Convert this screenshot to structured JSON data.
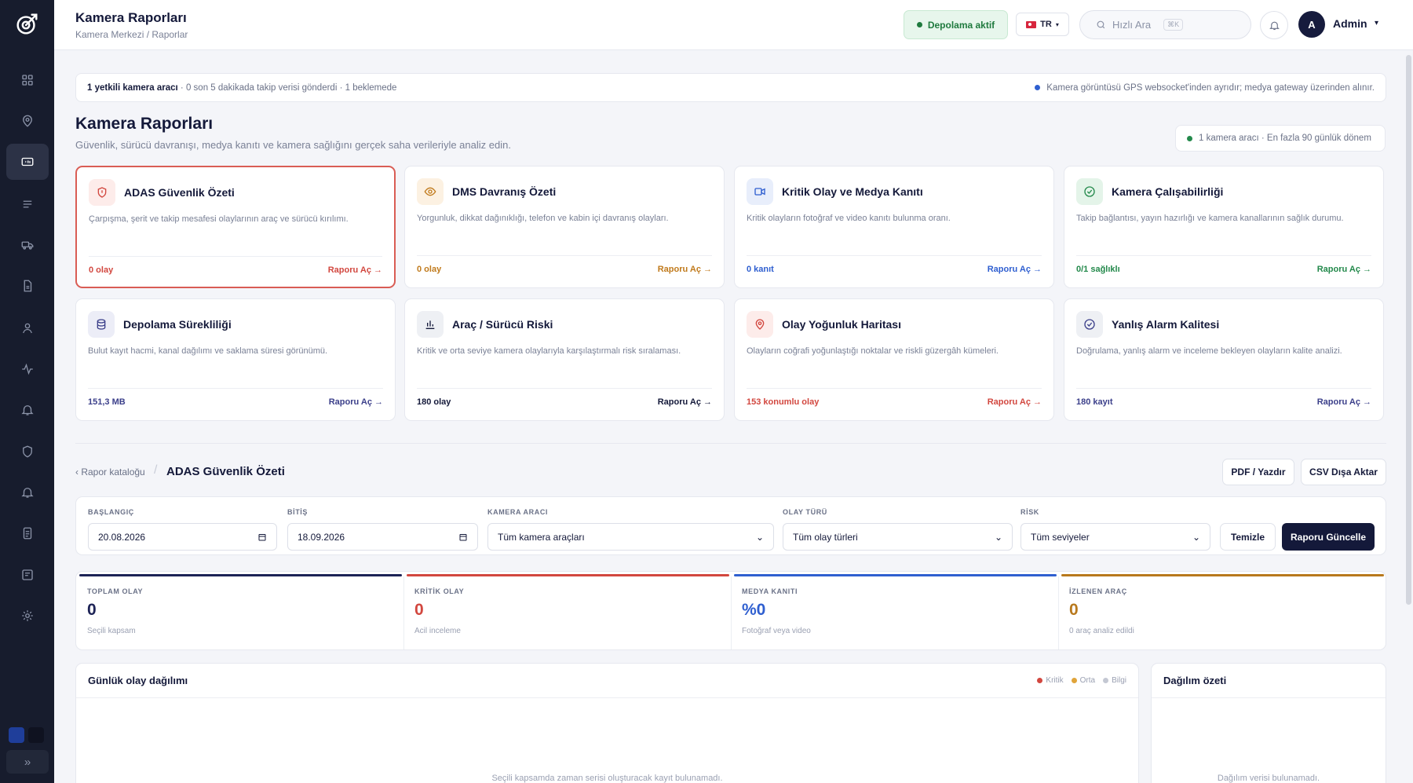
{
  "header": {
    "title": "Kamera Raporları",
    "breadcrumb": "Kamera Merkezi / Raporlar",
    "storage_status": "Depolama aktif",
    "language": "TR",
    "search_placeholder": "Hızlı Ara",
    "search_shortcut": "⌘K",
    "avatar_initial": "A",
    "user_name": "Admin"
  },
  "sidebar": {
    "icons": [
      "grid-icon",
      "map-pin-icon",
      "camera-report-icon",
      "list-icon",
      "truck-icon",
      "document-icon",
      "user-icon",
      "activity-icon",
      "bell-icon",
      "shield-icon",
      "alarm-icon",
      "file-icon",
      "report-icon",
      "settings-icon"
    ],
    "expand_label": "»"
  },
  "banner": {
    "left_bold": "1 yetkili kamera aracı",
    "left_rest": " · 0 son 5 dakikada takip verisi gönderdi · 1 beklemede",
    "right": "Kamera görüntüsü GPS websocket'inden ayrıdır; medya gateway üzerinden alınır."
  },
  "page": {
    "title": "Kamera Raporları",
    "subtitle": "Güvenlik, sürücü davranışı, medya kanıtı ve kamera sağlığını gerçek saha verileriyle analiz edin.",
    "scope": "1 kamera aracı · En fazla 90 günlük dönem"
  },
  "cards": [
    {
      "title": "ADAS Güvenlik Özeti",
      "desc": "Çarpışma, şerit ve takip mesafesi olaylarının araç ve sürücü kırılımı.",
      "metric": "0 olay",
      "link": "Raporu Aç →",
      "color": "#d2473f",
      "icon": "shield-icon",
      "bg": "#fdecea"
    },
    {
      "title": "DMS Davranış Özeti",
      "desc": "Yorgunluk, dikkat dağınıklığı, telefon ve kabin içi davranış olayları.",
      "metric": "0 olay",
      "link": "Raporu Aç →",
      "color": "#c07a1c",
      "icon": "eye-icon",
      "bg": "#fcf1e2"
    },
    {
      "title": "Kritik Olay ve Medya Kanıtı",
      "desc": "Kritik olayların fotoğraf ve video kanıtı bulunma oranı.",
      "metric": "0 kanıt",
      "link": "Raporu Aç →",
      "color": "#2f5fd0",
      "icon": "video-icon",
      "bg": "#e8eefb"
    },
    {
      "title": "Kamera Çalışabilirliği",
      "desc": "Takip bağlantısı, yayın hazırlığı ve kamera kanallarının sağlık durumu.",
      "metric": "0/1 sağlıklı",
      "link": "Raporu Aç →",
      "color": "#23894b",
      "icon": "check-circle-icon",
      "bg": "#e4f4e9"
    },
    {
      "title": "Depolama Sürekliliği",
      "desc": "Bulut kayıt hacmi, kanal dağılımı ve saklama süresi görünümü.",
      "metric": "151,3 MB",
      "link": "Raporu Aç →",
      "color": "#3b3f8a",
      "icon": "database-icon",
      "bg": "#ecedf7"
    },
    {
      "title": "Araç / Sürücü Riski",
      "desc": "Kritik ve orta seviye kamera olaylarıyla karşılaştırmalı risk sıralaması.",
      "metric": "180 olay",
      "link": "Raporu Aç →",
      "color": "#14193a",
      "icon": "bar-chart-icon",
      "bg": "#eef0f4"
    },
    {
      "title": "Olay Yoğunluk Haritası",
      "desc": "Olayların coğrafi yoğunlaştığı noktalar ve riskli güzergâh kümeleri.",
      "metric": "153 konumlu olay",
      "link": "Raporu Aç →",
      "color": "#d2473f",
      "icon": "map-pin-icon",
      "bg": "#fdecea"
    },
    {
      "title": "Yanlış Alarm Kalitesi",
      "desc": "Doğrulama, yanlış alarm ve inceleme bekleyen olayların kalite analizi.",
      "metric": "180 kayıt",
      "link": "Raporu Aç →",
      "color": "#3b3f8a",
      "icon": "check-circle-icon",
      "bg": "#eef0f4"
    }
  ],
  "report": {
    "back_label": "‹ Rapor kataloğu",
    "current": "ADAS Güvenlik Özeti",
    "pdf_button": "PDF / Yazdır",
    "csv_button": "CSV Dışa Aktar"
  },
  "filters": {
    "start_label": "BAŞLANGIÇ",
    "start_value": "20.08.2026",
    "end_label": "BİTİŞ",
    "end_value": "18.09.2026",
    "vehicle_label": "KAMERA ARACI",
    "vehicle_value": "Tüm kamera araçları",
    "type_label": "OLAY TÜRÜ",
    "type_value": "Tüm olay türleri",
    "risk_label": "RİSK",
    "risk_value": "Tüm seviyeler",
    "clear_button": "Temizle",
    "update_button": "Raporu Güncelle"
  },
  "kpis": [
    {
      "label": "TOPLAM OLAY",
      "value": "0",
      "sub": "Seçili kapsam",
      "color": "#1d2356"
    },
    {
      "label": "KRİTİK OLAY",
      "value": "0",
      "sub": "Acil inceleme",
      "color": "#d2473f"
    },
    {
      "label": "MEDYA KANITI",
      "value": "%0",
      "sub": "Fotoğraf veya video",
      "color": "#2f5fd0"
    },
    {
      "label": "İZLENEN ARAÇ",
      "value": "0",
      "sub": "0 araç analiz edildi",
      "color": "#b8791d"
    }
  ],
  "daily_chart": {
    "title": "Günlük olay dağılımı",
    "legend": [
      {
        "label": "Kritik",
        "color": "#d2473f"
      },
      {
        "label": "Orta",
        "color": "#e0a43a"
      },
      {
        "label": "Bilgi",
        "color": "#c4c8d3"
      }
    ],
    "empty": "Seçili kapsamda zaman serisi oluşturacak kayıt bulunamadı."
  },
  "distribution": {
    "title": "Dağılım özeti",
    "empty": "Dağılım verisi bulunamadı."
  },
  "colors": {
    "sidebar": "#171c2d",
    "primary": "#14193a",
    "storage_green": "#1f7a3e"
  }
}
